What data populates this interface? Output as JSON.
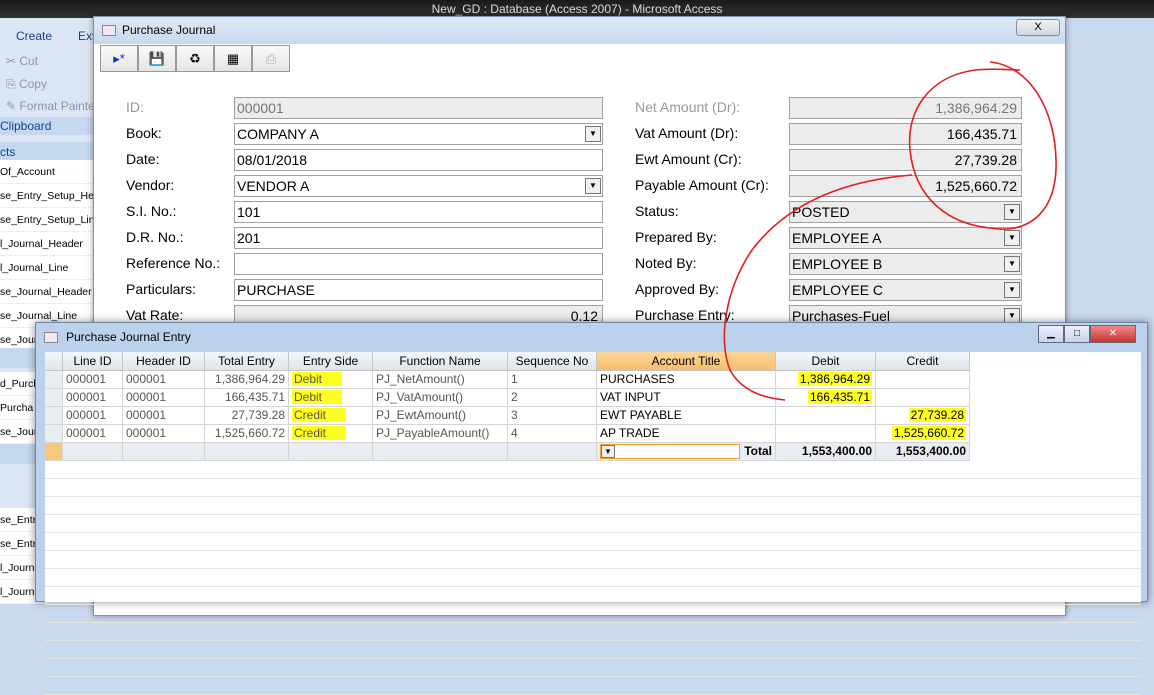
{
  "app_title": "New_GD : Database (Access 2007) - Microsoft Access",
  "ribbon": {
    "tabs": [
      "Create",
      "Ext"
    ],
    "clipboard": [
      "Cut",
      "Copy",
      "Format Painter"
    ],
    "group_label": "Clipboard"
  },
  "nav": {
    "header": "cts",
    "items": [
      "Of_Account",
      "se_Entry_Setup_He",
      "se_Entry_Setup_Lin",
      "l_Journal_Header",
      "l_Journal_Line",
      "se_Journal_Header",
      "se_Journal_Line",
      "se_Jour",
      "d_Purch",
      "Purcha",
      "se_Jour",
      "se_Entr",
      "se_Entr",
      "l_Journ",
      "l_Journ"
    ]
  },
  "form": {
    "title": "Purchase Journal",
    "close": "X",
    "toolbar": [
      "new-record",
      "save",
      "delete",
      "datasheet",
      "print"
    ],
    "left": [
      {
        "label": "ID:",
        "value": "000001",
        "dim": true
      },
      {
        "label": "Book:",
        "value": "COMPANY A",
        "dd": true
      },
      {
        "label": "Date:",
        "value": "08/01/2018"
      },
      {
        "label": "Vendor:",
        "value": "VENDOR A",
        "dd": true
      },
      {
        "label": "S.I. No.:",
        "value": "101"
      },
      {
        "label": "D.R. No.:",
        "value": "201"
      },
      {
        "label": "Reference No.:",
        "value": ""
      },
      {
        "label": "Particulars:",
        "value": "PURCHASE"
      },
      {
        "label": "Vat Rate:",
        "value": "0.12",
        "num": true
      }
    ],
    "right": [
      {
        "label": "Net Amount (Dr):",
        "value": "1,386,964.29",
        "num": true,
        "dim": true
      },
      {
        "label": "Vat Amount (Dr):",
        "value": "166,435.71",
        "num": true
      },
      {
        "label": "Ewt Amount (Cr):",
        "value": "27,739.28",
        "num": true
      },
      {
        "label": "Payable Amount (Cr):",
        "value": "1,525,660.72",
        "num": true
      },
      {
        "label": "Status:",
        "value": "POSTED",
        "dd": true,
        "gray": true
      },
      {
        "label": "Prepared By:",
        "value": "EMPLOYEE A",
        "dd": true,
        "gray": true
      },
      {
        "label": "Noted By:",
        "value": "EMPLOYEE B",
        "dd": true,
        "gray": true
      },
      {
        "label": "Approved By:",
        "value": "EMPLOYEE C",
        "dd": true,
        "gray": true
      },
      {
        "label": "Purchase Entry:",
        "value": "Purchases-Fuel",
        "dd": true,
        "gray": true
      }
    ]
  },
  "subform": {
    "title": "Purchase Journal Entry",
    "columns": [
      "Line ID",
      "Header ID",
      "Total Entry",
      "Entry Side",
      "Function Name",
      "Sequence No",
      "Account Title",
      "Debit",
      "Credit"
    ],
    "rows": [
      [
        "000001",
        "000001",
        "1,386,964.29",
        "Debit",
        "PJ_NetAmount()",
        "1",
        "PURCHASES",
        "1,386,964.29",
        ""
      ],
      [
        "000001",
        "000001",
        "166,435.71",
        "Debit",
        "PJ_VatAmount()",
        "2",
        "VAT INPUT",
        "166,435.71",
        ""
      ],
      [
        "000001",
        "000001",
        "27,739.28",
        "Credit",
        "PJ_EwtAmount()",
        "3",
        "EWT PAYABLE",
        "",
        "27,739.28"
      ],
      [
        "000001",
        "000001",
        "1,525,660.72",
        "Credit",
        "PJ_PayableAmount()",
        "4",
        "AP TRADE",
        "",
        "1,525,660.72"
      ]
    ],
    "total_label": "Total",
    "total_debit": "1,553,400.00",
    "total_credit": "1,553,400.00"
  },
  "colors": {
    "highlight": "#ffff20",
    "annotation": "#e02020",
    "selected_col": "#f9c97a"
  }
}
